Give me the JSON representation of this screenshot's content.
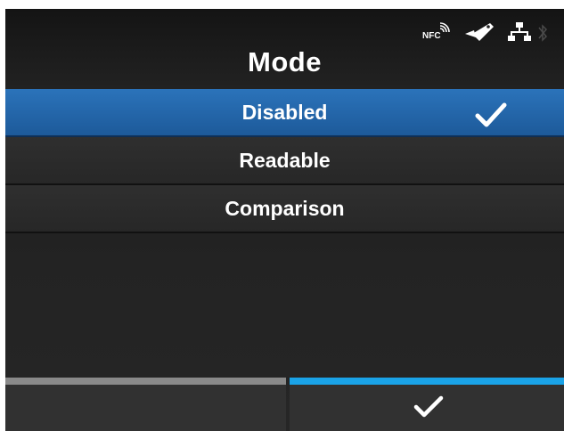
{
  "header": {
    "title": "Mode",
    "status_icons": [
      "nfc-icon",
      "tag-icon",
      "network-icon",
      "bluetooth-icon"
    ],
    "nfc_label": "NFC"
  },
  "options": [
    {
      "label": "Disabled",
      "selected": true
    },
    {
      "label": "Readable",
      "selected": false
    },
    {
      "label": "Comparison",
      "selected": false
    }
  ],
  "footer": {
    "left_button": {
      "label": "",
      "accent": "#8a8a8a"
    },
    "right_button": {
      "icon": "check-icon",
      "accent": "#1aa3e8"
    }
  },
  "colors": {
    "selected_row": "#2b73ba",
    "background": "#222222",
    "text": "#ffffff"
  }
}
